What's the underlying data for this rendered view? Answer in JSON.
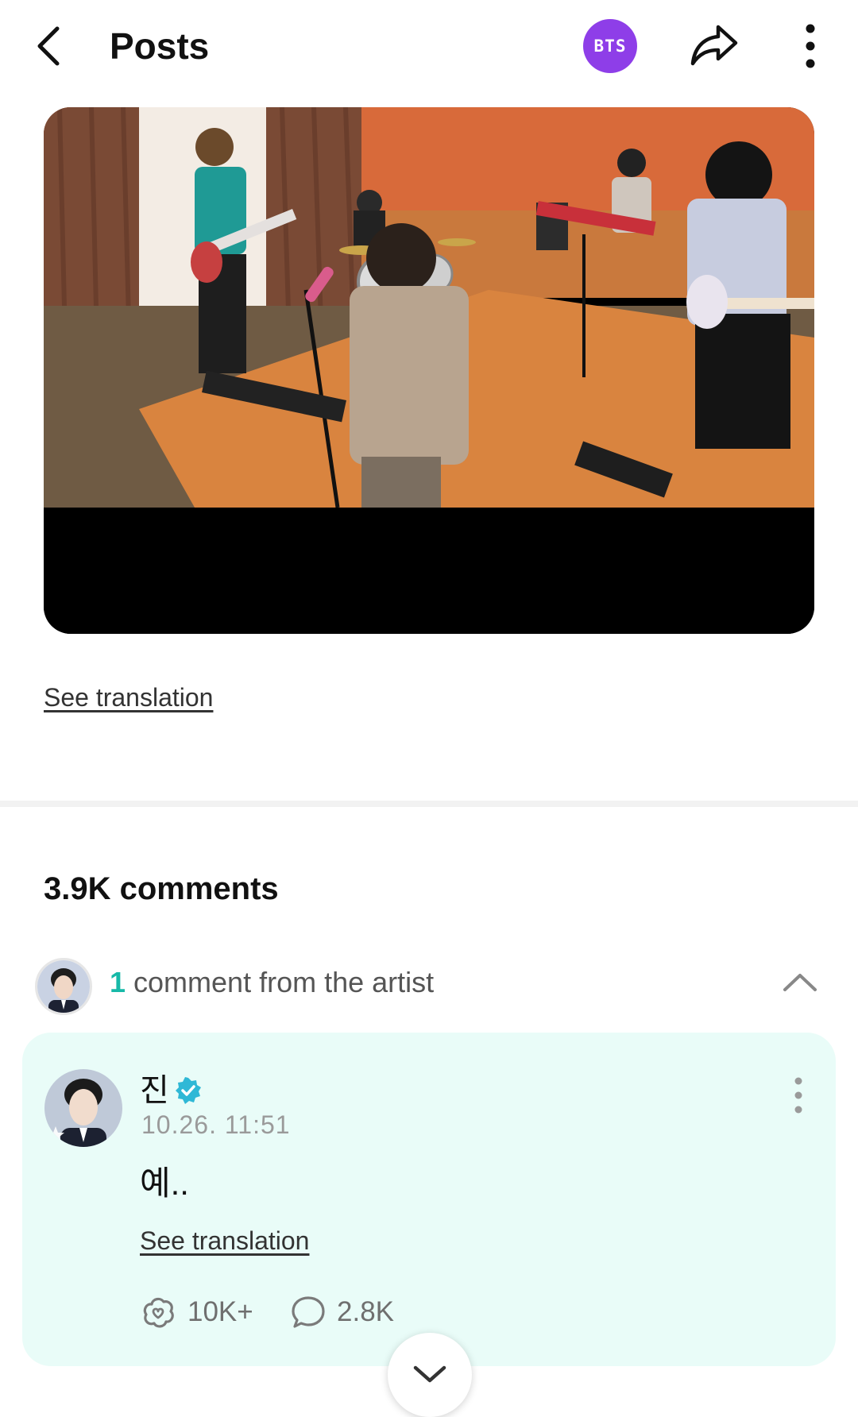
{
  "header": {
    "title": "Posts",
    "community_badge": "BTS",
    "back_icon": "chevron-left-icon",
    "share_icon": "share-arrow-icon",
    "more_icon": "vertical-dots-icon",
    "badge_color": "#8e3ee8"
  },
  "post": {
    "media_type": "video",
    "see_translation_label": "See translation"
  },
  "comments": {
    "count_label": "3.9K comments",
    "artist_section": {
      "count": "1",
      "label": "comment from the artist",
      "collapse_icon": "chevron-up-icon"
    },
    "artist_comment": {
      "name": "진",
      "verified": true,
      "time": "10.26. 11:51",
      "body": "예..",
      "see_translation_label": "See translation",
      "like_count": "10K+",
      "reply_count": "2.8K",
      "like_icon": "like-icon",
      "reply_icon": "speech-bubble-icon",
      "accent_color": "#17b9a8",
      "card_color": "#e9fcf8"
    },
    "expand_icon": "chevron-down-icon"
  }
}
